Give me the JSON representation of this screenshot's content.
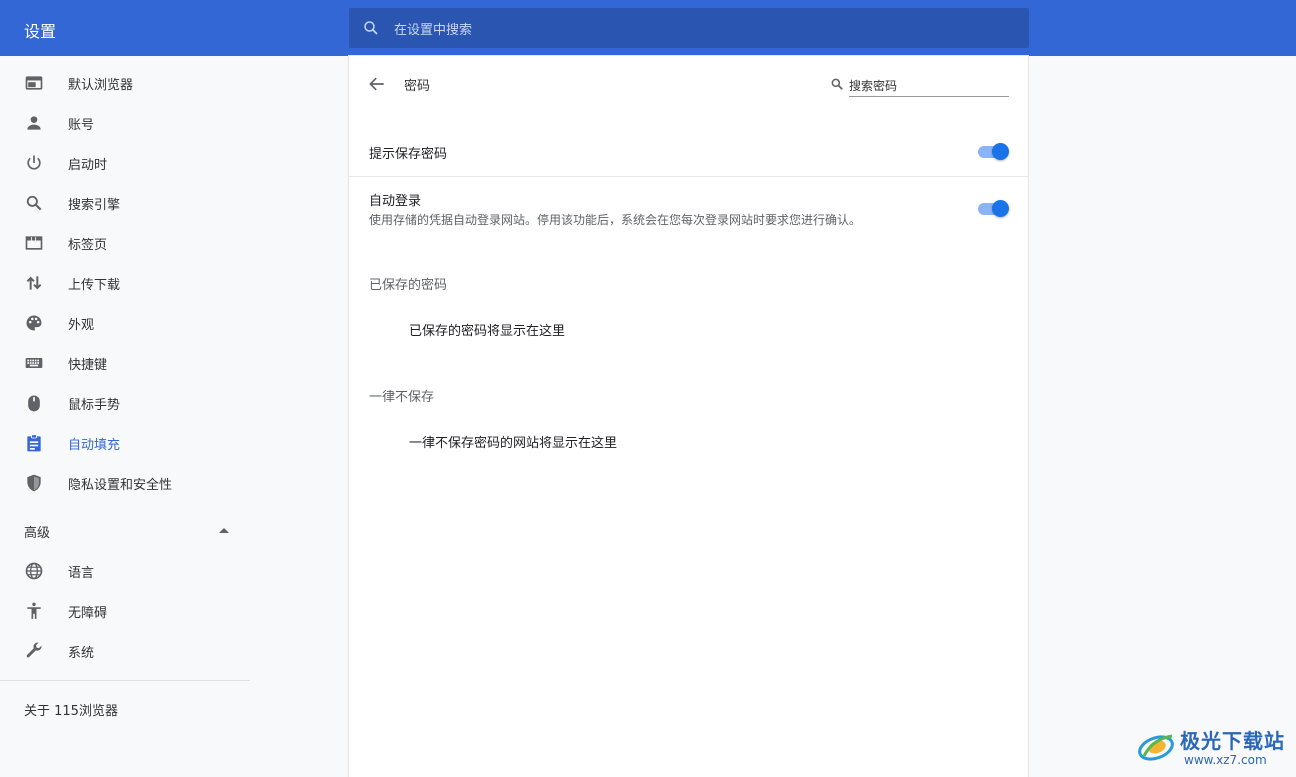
{
  "header": {
    "title": "设置",
    "search_placeholder": "在设置中搜索"
  },
  "sidebar": {
    "items": [
      {
        "label": "默认浏览器",
        "icon": "browser-window-icon"
      },
      {
        "label": "账号",
        "icon": "person-icon"
      },
      {
        "label": "启动时",
        "icon": "power-icon"
      },
      {
        "label": "搜索引擎",
        "icon": "search-icon"
      },
      {
        "label": "标签页",
        "icon": "tab-icon"
      },
      {
        "label": "上传下载",
        "icon": "up-down-arrows-icon"
      },
      {
        "label": "外观",
        "icon": "palette-icon"
      },
      {
        "label": "快捷键",
        "icon": "keyboard-icon"
      },
      {
        "label": "鼠标手势",
        "icon": "mouse-icon"
      },
      {
        "label": "自动填充",
        "icon": "clipboard-icon",
        "active": true
      },
      {
        "label": "隐私设置和安全性",
        "icon": "shield-icon"
      }
    ],
    "advanced_label": "高级",
    "advanced_items": [
      {
        "label": "语言",
        "icon": "globe-icon"
      },
      {
        "label": "无障碍",
        "icon": "accessibility-icon"
      },
      {
        "label": "系统",
        "icon": "wrench-icon"
      }
    ],
    "about_label": "关于 115浏览器"
  },
  "main": {
    "title": "密码",
    "search_placeholder": "搜索密码",
    "offer_to_save": {
      "label": "提示保存密码",
      "enabled": true
    },
    "auto_signin": {
      "label": "自动登录",
      "description": "使用存储的凭据自动登录网站。停用该功能后，系统会在您每次登录网站时要求您进行确认。",
      "enabled": true
    },
    "saved_passwords": {
      "title": "已保存的密码",
      "empty_message": "已保存的密码将显示在这里"
    },
    "never_saved": {
      "title": "一律不保存",
      "empty_message": "一律不保存密码的网站将显示在这里"
    }
  },
  "watermark": {
    "text": "极光下载站",
    "url": "www.xz7.com"
  },
  "colors": {
    "header_bg": "#3367d6",
    "search_bg": "#2a56b2",
    "accent": "#1a73e8",
    "toggle_track": "#8ab4f8",
    "sidebar_bg": "#f8f9fa"
  }
}
